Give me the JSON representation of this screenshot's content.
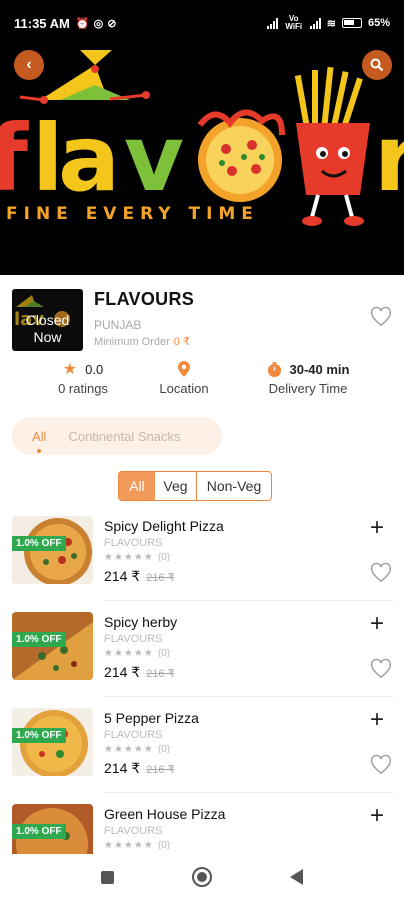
{
  "status_bar": {
    "time": "11:35 AM",
    "battery": "65%",
    "network_label": "Vo WiFi"
  },
  "header": {
    "back_icon": "chevron-left-icon",
    "search_icon": "search-icon",
    "banner_text": "FINE EVERY TIME",
    "banner_logo_text": "Flavours"
  },
  "restaurant": {
    "name": "FLAVOURS",
    "city": "PUNJAB",
    "min_order_label": "Minimum Order",
    "min_order_value": "0 ₹",
    "status": "Closed Now",
    "rating": "0.0",
    "rating_label": "0 ratings",
    "location_label": "Location",
    "delivery_time": "30-40 min",
    "delivery_label": "Delivery Time"
  },
  "categories": [
    "All",
    "Continental Snacks"
  ],
  "filters": [
    "All",
    "Veg",
    "Non-Veg"
  ],
  "items": [
    {
      "name": "Spicy Delight Pizza",
      "brand": "FLAVOURS",
      "stars": "★★★★★",
      "count": "(0)",
      "price": "214 ₹",
      "old_price": "216 ₹",
      "discount": "1.0% OFF"
    },
    {
      "name": "Spicy herby",
      "brand": "FLAVOURS",
      "stars": "★★★★★",
      "count": "(0)",
      "price": "214 ₹",
      "old_price": "216 ₹",
      "discount": "1.0% OFF"
    },
    {
      "name": "5 Pepper Pizza",
      "brand": "FLAVOURS",
      "stars": "★★★★★",
      "count": "(0)",
      "price": "214 ₹",
      "old_price": "216 ₹",
      "discount": "1.0% OFF"
    },
    {
      "name": "Green House Pizza",
      "brand": "FLAVOURS",
      "stars": "★★★★★",
      "count": "(0)",
      "price": "214 ₹",
      "old_price": "216 ₹",
      "discount": "1.0% OFF"
    }
  ],
  "colors": {
    "accent": "#f08a3c",
    "discount": "#2fa84f",
    "header_button": "#c45a1f"
  }
}
